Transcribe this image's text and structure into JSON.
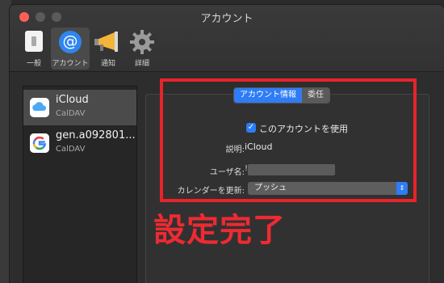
{
  "window": {
    "title": "アカウント"
  },
  "toolbar": {
    "items": [
      {
        "label": "一般",
        "icon": "toggle-switch-icon"
      },
      {
        "label": "アカウント",
        "icon": "at-sign-icon",
        "selected": true
      },
      {
        "label": "通知",
        "icon": "megaphone-icon"
      },
      {
        "label": "詳細",
        "icon": "gear-icon"
      }
    ],
    "account_glyph": "@"
  },
  "accounts": [
    {
      "name": "iCloud",
      "type": "CalDAV",
      "icon": "icloud-icon",
      "selected": true
    },
    {
      "name": "gen.a092801...",
      "type": "CalDAV",
      "icon": "google-icon",
      "selected": false
    }
  ],
  "tabs": {
    "info": "アカウント情報",
    "delegation": "委任"
  },
  "form": {
    "enable_label": "このアカウントを使用",
    "enable_checked": true,
    "description_label": "説明:",
    "description_value": "iCloud",
    "username_label": "ユーザ名:",
    "username_value": "!",
    "refresh_label": "カレンダーを更新:",
    "refresh_value": "プッシュ"
  },
  "annotation": {
    "text": "設定完了",
    "color": "#ee2a32"
  },
  "colors": {
    "accent": "#2e7cf6",
    "close": "#ff5f57"
  }
}
